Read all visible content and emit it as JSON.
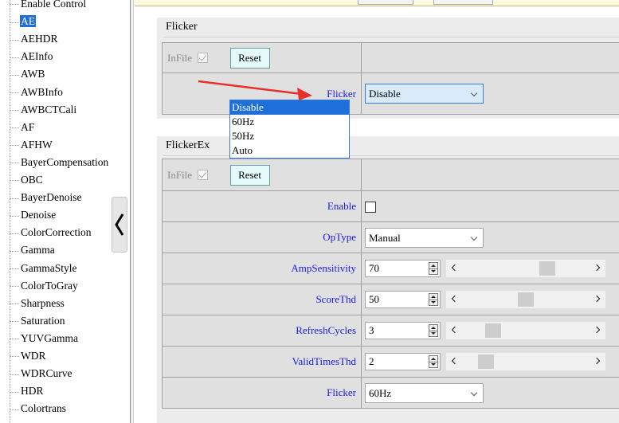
{
  "sidebar": {
    "items": [
      {
        "label": "Enable Control",
        "selected": false
      },
      {
        "label": "AE",
        "selected": true
      },
      {
        "label": "AEHDR",
        "selected": false
      },
      {
        "label": "AEInfo",
        "selected": false
      },
      {
        "label": "AWB",
        "selected": false
      },
      {
        "label": "AWBInfo",
        "selected": false
      },
      {
        "label": "AWBCTCali",
        "selected": false
      },
      {
        "label": "AF",
        "selected": false
      },
      {
        "label": "AFHW",
        "selected": false
      },
      {
        "label": "BayerCompensation",
        "selected": false
      },
      {
        "label": "OBC",
        "selected": false
      },
      {
        "label": "BayerDenoise",
        "selected": false
      },
      {
        "label": "Denoise",
        "selected": false
      },
      {
        "label": "ColorCorrection",
        "selected": false
      },
      {
        "label": "Gamma",
        "selected": false
      },
      {
        "label": "GammaStyle",
        "selected": false
      },
      {
        "label": "ColorToGray",
        "selected": false
      },
      {
        "label": "Sharpness",
        "selected": false
      },
      {
        "label": "Saturation",
        "selected": false
      },
      {
        "label": "YUVGamma",
        "selected": false
      },
      {
        "label": "WDR",
        "selected": false
      },
      {
        "label": "WDRCurve",
        "selected": false
      },
      {
        "label": "HDR",
        "selected": false
      },
      {
        "label": "Colortrans",
        "selected": false
      }
    ]
  },
  "flicker_section": {
    "title": "Flicker",
    "infile_label": "InFile",
    "infile_checked": true,
    "reset_label": "Reset",
    "flicker_label": "Flicker",
    "flicker_value": "Disable",
    "dropdown_options": [
      "Disable",
      "60Hz",
      "50Hz",
      "Auto"
    ],
    "dropdown_highlighted": "Disable"
  },
  "flickerex_section": {
    "title": "FlickerEx",
    "infile_label": "InFile",
    "infile_checked": true,
    "reset_label": "Reset",
    "enable_label": "Enable",
    "enable_checked": false,
    "optype_label": "OpType",
    "optype_value": "Manual",
    "amp_label": "AmpSensitivity",
    "amp_value": "70",
    "amp_slider_fraction": 0.7,
    "score_label": "ScoreThd",
    "score_value": "50",
    "score_slider_fraction": 0.5,
    "refresh_label": "RefreshCycles",
    "refresh_value": "3",
    "refresh_slider_fraction": 0.2,
    "valid_label": "ValidTimesThd",
    "valid_value": "2",
    "valid_slider_fraction": 0.13,
    "flicker_label": "Flicker",
    "flicker_value": "60Hz"
  },
  "colors": {
    "label_blue": "#1a1ae6",
    "selection_blue": "#1e6fd9",
    "arrow_red": "#e8302a",
    "reset_bg": "#e4fafa"
  },
  "icons": {
    "collapse": "chevron-left-icon",
    "slider_left": "chevron-left-icon",
    "slider_right": "chevron-right-icon",
    "select_caret": "chevron-down-icon",
    "spin": "spinner-arrows-icon"
  }
}
